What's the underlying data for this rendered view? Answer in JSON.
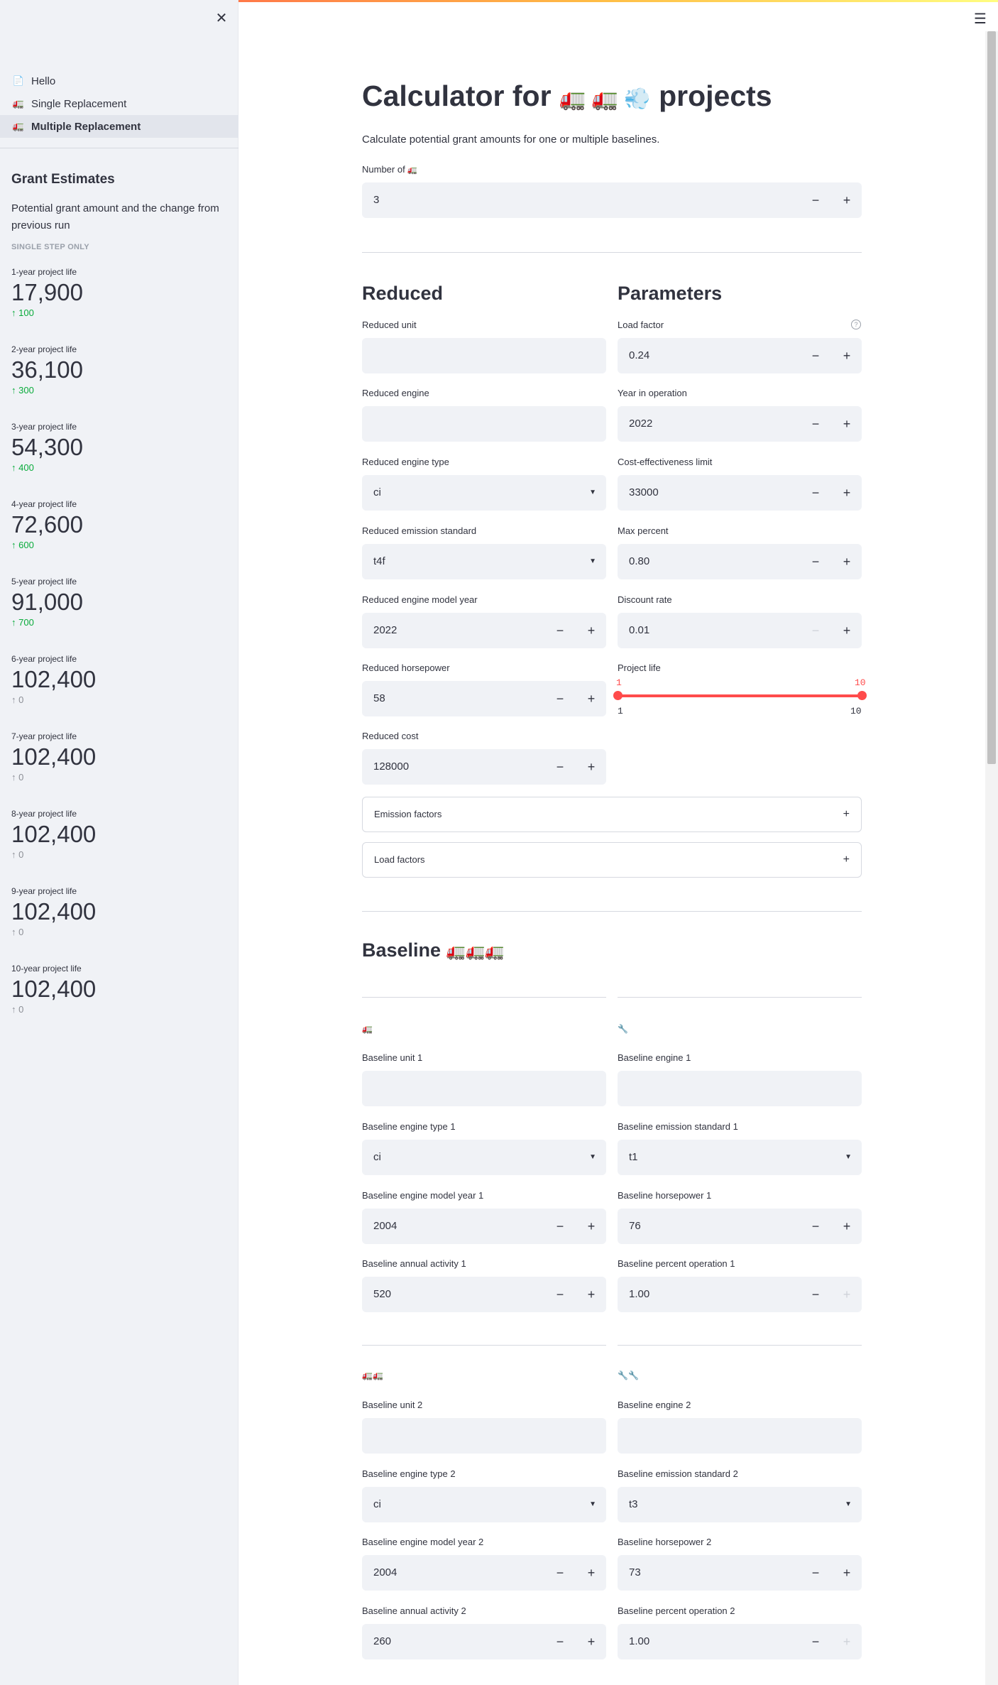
{
  "sidebar": {
    "nav": [
      {
        "label": "Hello",
        "icon": "📄"
      },
      {
        "label": "Single Replacement",
        "icon": "🚛"
      },
      {
        "label": "Multiple Replacement",
        "icon": "🚛"
      }
    ],
    "title": "Grant Estimates",
    "description": "Potential grant amount and the change from previous run",
    "caption": "SINGLE STEP ONLY",
    "metrics": [
      {
        "label": "1-year project life",
        "value": "17,900",
        "delta": "100"
      },
      {
        "label": "2-year project life",
        "value": "36,100",
        "delta": "300"
      },
      {
        "label": "3-year project life",
        "value": "54,300",
        "delta": "400"
      },
      {
        "label": "4-year project life",
        "value": "72,600",
        "delta": "600"
      },
      {
        "label": "5-year project life",
        "value": "91,000",
        "delta": "700"
      },
      {
        "label": "6-year project life",
        "value": "102,400",
        "delta": "0"
      },
      {
        "label": "7-year project life",
        "value": "102,400",
        "delta": "0"
      },
      {
        "label": "8-year project life",
        "value": "102,400",
        "delta": "0"
      },
      {
        "label": "9-year project life",
        "value": "102,400",
        "delta": "0"
      },
      {
        "label": "10-year project life",
        "value": "102,400",
        "delta": "0"
      }
    ]
  },
  "main": {
    "title_prefix": "Calculator for",
    "title_emojis": "🚛 🚛 💨",
    "title_suffix": "projects",
    "intro": "Calculate potential grant amounts for one or multiple baselines.",
    "number_label": "Number of",
    "number_value": "3",
    "reduced_heading": "Reduced",
    "parameters_heading": "Parameters",
    "reduced": {
      "unit_label": "Reduced unit",
      "unit_value": "",
      "engine_label": "Reduced engine",
      "engine_value": "",
      "engine_type_label": "Reduced engine type",
      "engine_type_value": "ci",
      "emission_label": "Reduced emission standard",
      "emission_value": "t4f",
      "model_year_label": "Reduced engine model year",
      "model_year_value": "2022",
      "hp_label": "Reduced horsepower",
      "hp_value": "58",
      "cost_label": "Reduced cost",
      "cost_value": "128000"
    },
    "parameters": {
      "load_factor_label": "Load factor",
      "load_factor_value": "0.24",
      "year_label": "Year in operation",
      "year_value": "2022",
      "ce_label": "Cost-effectiveness limit",
      "ce_value": "33000",
      "max_label": "Max percent",
      "max_value": "0.80",
      "discount_label": "Discount rate",
      "discount_value": "0.01",
      "life_label": "Project life",
      "life_min": "1",
      "life_max": "10",
      "life_low": "1",
      "life_high": "10"
    },
    "expanders": [
      "Emission factors",
      "Load factors"
    ],
    "baseline_heading": "Baseline",
    "baseline_emojis": "🚛🚛🚛",
    "baselines": [
      {
        "icon_unit": "🚛",
        "icon_engine": "🔧",
        "unit_label": "Baseline unit 1",
        "unit_value": "",
        "engine_label": "Baseline engine 1",
        "engine_value": "",
        "engine_type_label": "Baseline engine type 1",
        "engine_type_value": "ci",
        "emission_label": "Baseline emission standard 1",
        "emission_value": "t1",
        "model_year_label": "Baseline engine model year 1",
        "model_year_value": "2004",
        "hp_label": "Baseline horsepower 1",
        "hp_value": "76",
        "activity_label": "Baseline annual activity 1",
        "activity_value": "520",
        "percent_label": "Baseline percent operation 1",
        "percent_value": "1.00"
      },
      {
        "icon_unit": "🚛🚛",
        "icon_engine": "🔧🔧",
        "unit_label": "Baseline unit 2",
        "unit_value": "",
        "engine_label": "Baseline engine 2",
        "engine_value": "",
        "engine_type_label": "Baseline engine type 2",
        "engine_type_value": "ci",
        "emission_label": "Baseline emission standard 2",
        "emission_value": "t3",
        "model_year_label": "Baseline engine model year 2",
        "model_year_value": "2004",
        "hp_label": "Baseline horsepower 2",
        "hp_value": "73",
        "activity_label": "Baseline annual activity 2",
        "activity_value": "260",
        "percent_label": "Baseline percent operation 2",
        "percent_value": "1.00"
      }
    ]
  },
  "colors": {
    "accent": "#ff4b4b",
    "delta_up": "#09ab3b",
    "sidebar_bg": "#f0f2f6"
  }
}
